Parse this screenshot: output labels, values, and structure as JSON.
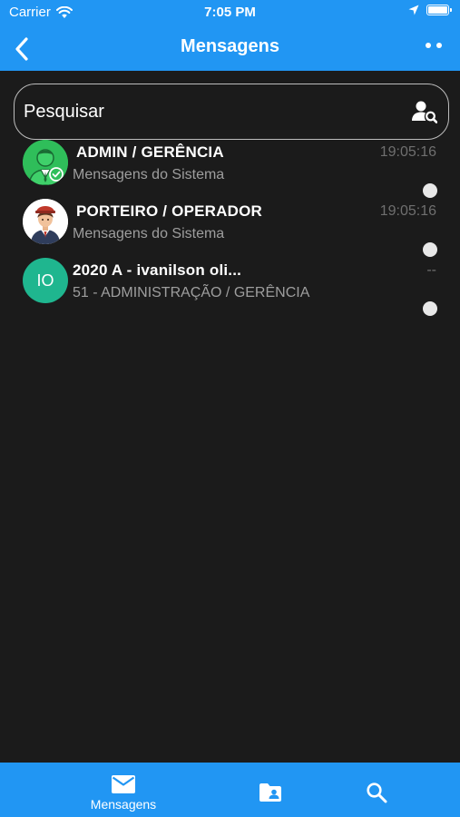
{
  "status_bar": {
    "carrier": "Carrier",
    "time": "7:05 PM"
  },
  "nav": {
    "title": "Mensagens",
    "back_icon": "chevron-left-icon",
    "more_icon": "more-dots-icon"
  },
  "search": {
    "placeholder": "Pesquisar",
    "icon": "person-search-icon"
  },
  "conversations": [
    {
      "title": "ADMIN / GERÊNCIA",
      "subtitle": "Mensagens do Sistema",
      "time": "19:05:16",
      "avatar": "admin-avatar",
      "avatar_color": "#2fbe5a"
    },
    {
      "title": "PORTEIRO / OPERADOR",
      "subtitle": "Mensagens do Sistema",
      "time": "19:05:16",
      "avatar": "porteiro-avatar",
      "avatar_color": "#ffffff"
    },
    {
      "title": "2020 A - ivanilson oli...",
      "subtitle": "51 - ADMINISTRAÇÃO / GERÊNCIA",
      "time": "--",
      "avatar_initials": "IO",
      "avatar_color": "#1fb68f"
    }
  ],
  "tabbar": {
    "tabs": [
      {
        "label": "Mensagens",
        "icon": "mail-icon",
        "active": true
      },
      {
        "label": "",
        "icon": "contacts-folder-icon",
        "active": false
      },
      {
        "label": "",
        "icon": "search-icon",
        "active": false
      }
    ]
  },
  "colors": {
    "primary": "#2196f3",
    "background": "#1b1b1b",
    "initials_avatar": "#1fb68f"
  }
}
